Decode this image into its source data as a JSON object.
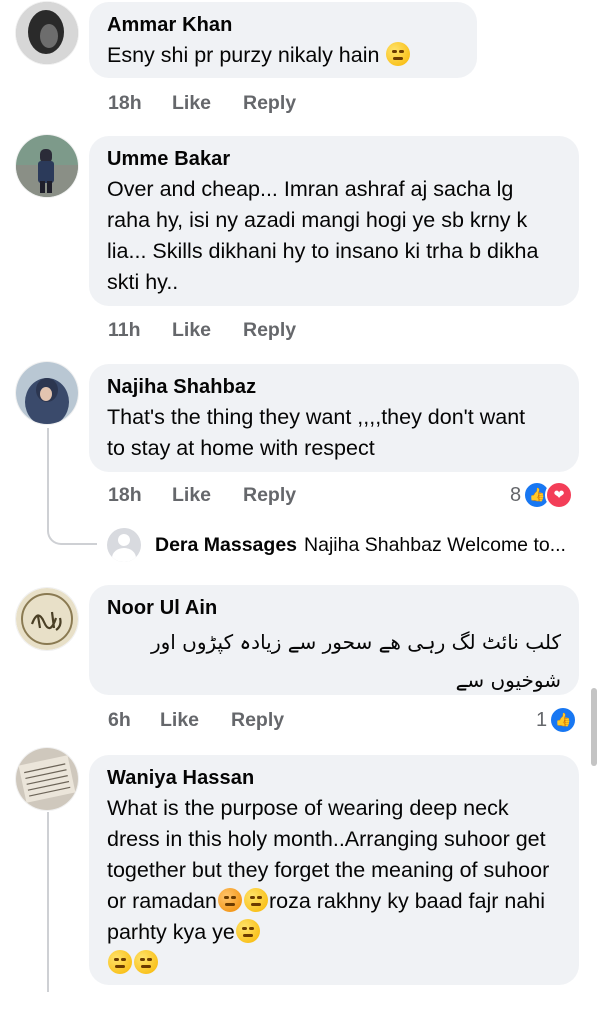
{
  "comments": [
    {
      "name": "Ammar Khan",
      "text": "Esny shi pr purzy nikaly hain",
      "time": "18h",
      "like": "Like",
      "reply": "Reply"
    },
    {
      "name": "Umme Bakar",
      "text": "Over and cheap... Imran ashraf aj sacha lg raha hy, isi ny azadi mangi hogi ye sb krny k lia... Skills dikhani hy to insano ki trha b dikha skti hy..",
      "time": "11h",
      "like": "Like",
      "reply": "Reply"
    },
    {
      "name": "Najiha Shahbaz",
      "text": "That's the thing they want ,,,,they don't want to stay at home with respect",
      "time": "18h",
      "like": "Like",
      "reply": "Reply",
      "reaction_count": "8"
    },
    {
      "name": "Noor Ul Ain",
      "text": "کلب نائٹ لگ رہی ھے سحور سے زیادہ کپڑوں اور شوخیوں سے",
      "time": "6h",
      "like": "Like",
      "reply": "Reply",
      "reaction_count": "1"
    },
    {
      "name": "Waniya Hassan",
      "text": "What is the purpose of wearing deep neck dress in this holy month..Arranging suhoor get together but they forget the meaning of suhoor or ramadan",
      "text2": "roza rakhny ky baad fajr nahi parhty kya ye"
    }
  ],
  "reply_preview": {
    "name": "Dera Massages",
    "text": "Najiha Shahbaz Welcome to..."
  },
  "colors": {
    "bubble": "#f0f2f5",
    "meta": "#65676b",
    "like_blue": "#1877f2",
    "love_red": "#f33e58"
  }
}
